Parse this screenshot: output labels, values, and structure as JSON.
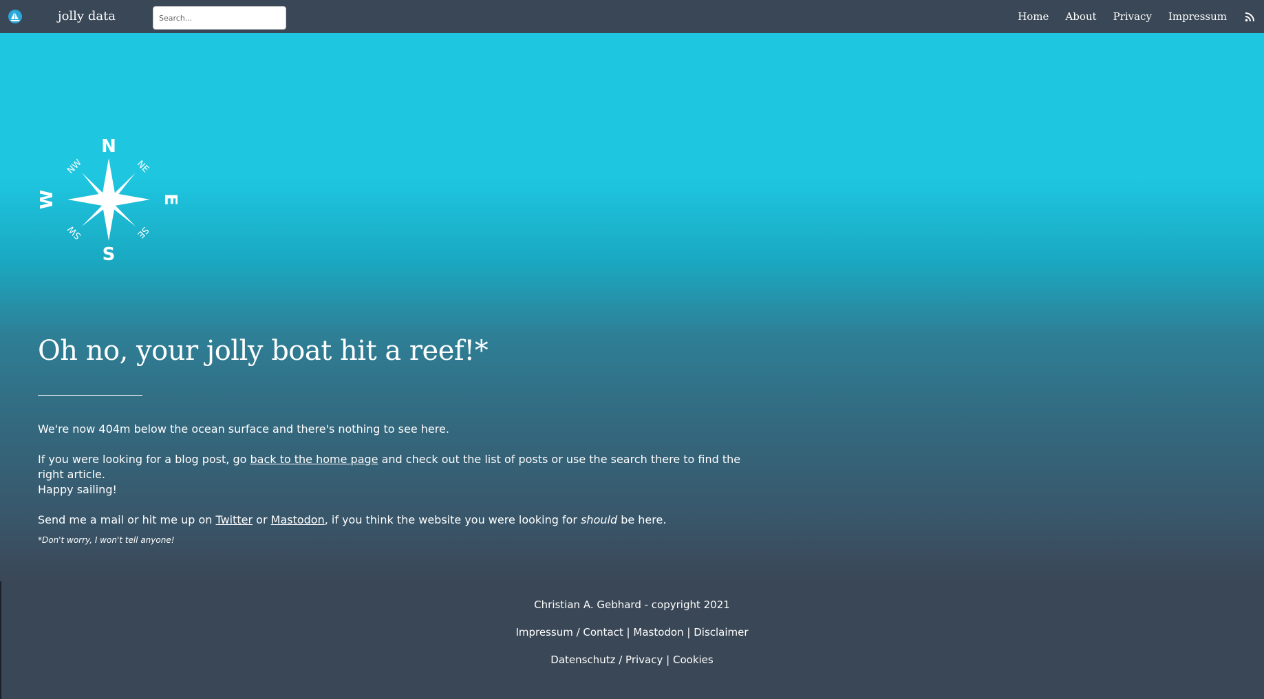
{
  "nav": {
    "brand": "jolly data",
    "search_placeholder": "Search...",
    "links": [
      "Home",
      "About",
      "Privacy",
      "Impressum"
    ]
  },
  "compass": {
    "n": "N",
    "e": "E",
    "s": "S",
    "w": "W",
    "ne": "NE",
    "nw": "NW",
    "se": "SE",
    "sw": "SW"
  },
  "main": {
    "title": "Oh no, your jolly boat hit a reef!*",
    "p1": "We're now 404m below the ocean surface and there's nothing to see here.",
    "p2_before": "If you were looking for a blog post, go ",
    "p2_link": "back to the home page",
    "p2_after": " and check out the list of posts or use the search there to find the right article.",
    "p2_line2": "Happy sailing!",
    "p3_before": "Send me a mail or hit me up on ",
    "p3_link1": "Twitter",
    "p3_mid": " or ",
    "p3_link2": "Mastodon",
    "p3_after1": ", if you think the website you were looking for ",
    "p3_em": "should",
    "p3_after2": " be here.",
    "footnote": "*Don't worry, I won't tell anyone!"
  },
  "footer": {
    "copyright": "Christian A. Gebhard - copyright 2021",
    "impressum": "Impressum / Contact",
    "sep": "|",
    "mastodon": "Mastodon",
    "disclaimer": "Disclaimer",
    "privacy": "Datenschutz / Privacy",
    "cookies": "Cookies"
  },
  "colors": {
    "nav_bg": "#3a4756",
    "sea_top": "#1ec6e0",
    "sea_bottom": "#3a4756"
  },
  "icons": {
    "logo": "sailboat-logo-icon",
    "feed": "rss-icon"
  }
}
